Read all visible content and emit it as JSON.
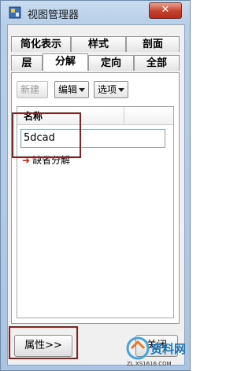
{
  "window": {
    "title": "视图管理器",
    "close_label": "✕"
  },
  "tabs_row1": [
    "简化表示",
    "样式",
    "剖面"
  ],
  "tabs_row2": [
    "层",
    "分解",
    "定向",
    "全部"
  ],
  "active_tab": "分解",
  "toolbar": {
    "new_label": "新建",
    "edit_label": "编辑",
    "options_label": "选项"
  },
  "list": {
    "column_header": "名称",
    "name_value": "5dcad",
    "default_item": "缺省分解"
  },
  "bottom": {
    "properties_label": "属性>>",
    "close_label": "关闭"
  },
  "watermark": {
    "text": "资料网",
    "url": "ZL.XS1616.COM"
  },
  "colors": {
    "highlight": "#8b2020",
    "arrow": "#c2261b",
    "close_button": "#c3402c"
  }
}
